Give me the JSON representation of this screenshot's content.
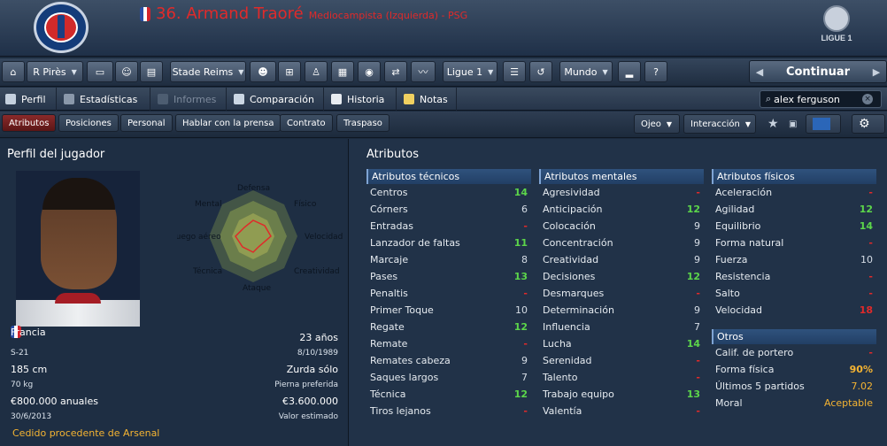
{
  "header": {
    "player_title": "36. Armand Traoré",
    "player_role": "Mediocampista (Izquierda) - PSG",
    "league_label": "LIGUE 1"
  },
  "toolbar": {
    "player_select": "R Pirès",
    "stadium_select": "Stade Reims",
    "league_select": "Ligue 1",
    "world_select": "Mundo",
    "continue_label": "Continuar"
  },
  "tabs": {
    "items": [
      "Perfil",
      "Estadísticas",
      "Informes",
      "Comparación",
      "Historia",
      "Notas"
    ]
  },
  "search": {
    "value": "alex ferguson"
  },
  "subtabs": {
    "items": [
      "Atributos",
      "Posiciones",
      "Personal",
      "Hablar con la prensa",
      "Contrato",
      "Traspaso"
    ],
    "eye_label": "Ojeo",
    "interaction_label": "Interacción"
  },
  "profile": {
    "title": "Perfil del jugador",
    "radar_labels": [
      "Defensa",
      "Físico",
      "Velocidad",
      "Creatividad",
      "Ataque",
      "Técnica",
      "Juego aéreo",
      "Mental"
    ],
    "nation": "Francia",
    "age": "23 años",
    "caps": "S-21",
    "dob": "8/10/1989",
    "height": "185 cm",
    "foot": "Zurda sólo",
    "weight": "70 kg",
    "foot_label": "Pierna preferida",
    "wage": "€800.000 anuales",
    "value": "€3.600.000",
    "contract_end": "30/6/2013",
    "value_label": "Valor estimado",
    "loan_note": "Cedido procedente de Arsenal"
  },
  "attributes": {
    "title": "Atributos",
    "technical_title": "Atributos técnicos",
    "technical": [
      {
        "name": "Centros",
        "value": "14",
        "tone": "green"
      },
      {
        "name": "Córners",
        "value": "6",
        "tone": "white"
      },
      {
        "name": "Entradas",
        "value": "-",
        "tone": "dash"
      },
      {
        "name": "Lanzador de faltas",
        "value": "11",
        "tone": "green"
      },
      {
        "name": "Marcaje",
        "value": "8",
        "tone": "white"
      },
      {
        "name": "Pases",
        "value": "13",
        "tone": "green"
      },
      {
        "name": "Penaltis",
        "value": "-",
        "tone": "dash"
      },
      {
        "name": "Primer Toque",
        "value": "10",
        "tone": "white"
      },
      {
        "name": "Regate",
        "value": "12",
        "tone": "green"
      },
      {
        "name": "Remate",
        "value": "-",
        "tone": "dash"
      },
      {
        "name": "Remates cabeza",
        "value": "9",
        "tone": "white"
      },
      {
        "name": "Saques largos",
        "value": "7",
        "tone": "white"
      },
      {
        "name": "Técnica",
        "value": "12",
        "tone": "green"
      },
      {
        "name": "Tiros lejanos",
        "value": "-",
        "tone": "dash"
      }
    ],
    "mental_title": "Atributos mentales",
    "mental": [
      {
        "name": "Agresividad",
        "value": "-",
        "tone": "dash"
      },
      {
        "name": "Anticipación",
        "value": "12",
        "tone": "green"
      },
      {
        "name": "Colocación",
        "value": "9",
        "tone": "white"
      },
      {
        "name": "Concentración",
        "value": "9",
        "tone": "white"
      },
      {
        "name": "Creatividad",
        "value": "9",
        "tone": "white"
      },
      {
        "name": "Decisiones",
        "value": "12",
        "tone": "green"
      },
      {
        "name": "Desmarques",
        "value": "-",
        "tone": "dash"
      },
      {
        "name": "Determinación",
        "value": "9",
        "tone": "white"
      },
      {
        "name": "Influencia",
        "value": "7",
        "tone": "white"
      },
      {
        "name": "Lucha",
        "value": "14",
        "tone": "green"
      },
      {
        "name": "Serenidad",
        "value": "-",
        "tone": "dash"
      },
      {
        "name": "Talento",
        "value": "-",
        "tone": "dash"
      },
      {
        "name": "Trabajo equipo",
        "value": "13",
        "tone": "green"
      },
      {
        "name": "Valentía",
        "value": "-",
        "tone": "dash"
      }
    ],
    "physical_title": "Atributos físicos",
    "physical": [
      {
        "name": "Aceleración",
        "value": "-",
        "tone": "dash"
      },
      {
        "name": "Agilidad",
        "value": "12",
        "tone": "green"
      },
      {
        "name": "Equilibrio",
        "value": "14",
        "tone": "green"
      },
      {
        "name": "Forma natural",
        "value": "-",
        "tone": "dash"
      },
      {
        "name": "Fuerza",
        "value": "10",
        "tone": "white"
      },
      {
        "name": "Resistencia",
        "value": "-",
        "tone": "dash"
      },
      {
        "name": "Salto",
        "value": "-",
        "tone": "dash"
      },
      {
        "name": "Velocidad",
        "value": "18",
        "tone": "red"
      }
    ],
    "other_title": "Otros",
    "other": [
      {
        "name": "Calif. de portero",
        "value": "-",
        "tone": "dash"
      },
      {
        "name": "Forma física",
        "value": "90%",
        "tone": "yellowbold"
      },
      {
        "name": "Últimos 5 partidos",
        "value": "7.02",
        "tone": "yellow"
      },
      {
        "name": "Moral",
        "value": "Aceptable",
        "tone": "yellow"
      }
    ]
  },
  "colors": {
    "accent_red": "#e02a2a",
    "good_green": "#5cd64a",
    "warn_yellow": "#f5b432",
    "panel_bg": "#213248"
  }
}
